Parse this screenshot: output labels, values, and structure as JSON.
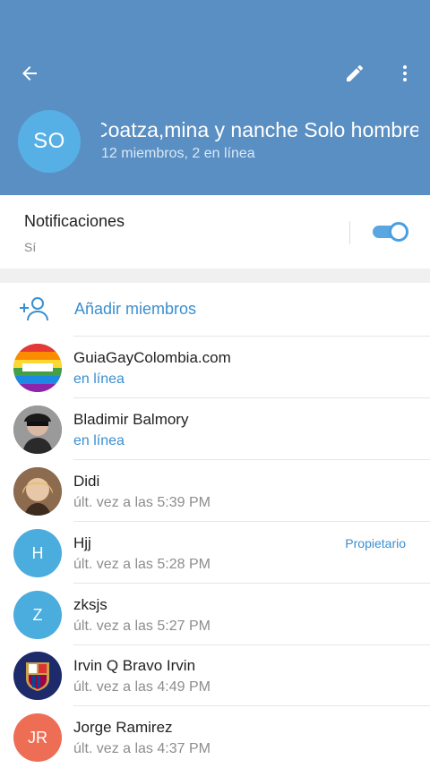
{
  "header": {
    "title": "Coatza,mina y nanche   Solo hombres",
    "subtitle": "12 miembros, 2 en línea",
    "avatar_initials": "SO",
    "avatar_color": "#56b0e6",
    "back_icon": "arrow-back-icon",
    "edit_icon": "pencil-icon",
    "more_icon": "more-vertical-icon",
    "background": "#5a8fc3"
  },
  "notifications": {
    "label": "Notificaciones",
    "value": "Sí",
    "enabled": true
  },
  "add_members": {
    "label": "Añadir miembros",
    "icon": "add-user-icon"
  },
  "members": [
    {
      "name": "GuiaGayColombia.com",
      "status": "en línea",
      "online": true,
      "role": "",
      "avatar": "photo"
    },
    {
      "name": "Bladimir Balmory",
      "status": "en línea",
      "online": true,
      "role": "",
      "avatar": "photo"
    },
    {
      "name": "Didi",
      "status": "últ. vez a las 5:39 PM",
      "online": false,
      "role": "",
      "avatar": "photo"
    },
    {
      "name": "Hjj",
      "status": "últ. vez a las 5:28 PM",
      "online": false,
      "role": "Propietario",
      "avatar": "H",
      "avatar_color": "#4bacde"
    },
    {
      "name": "zksjs",
      "status": "últ. vez a las 5:27 PM",
      "online": false,
      "role": "",
      "avatar": "Z",
      "avatar_color": "#4bacde"
    },
    {
      "name": "Irvin Q Bravo Irvin",
      "status": "últ. vez a las 4:49 PM",
      "online": false,
      "role": "",
      "avatar": "photo"
    },
    {
      "name": "Jorge Ramirez",
      "status": "últ. vez a las 4:37 PM",
      "online": false,
      "role": "",
      "avatar": "JR",
      "avatar_color": "#ee6e55"
    }
  ]
}
